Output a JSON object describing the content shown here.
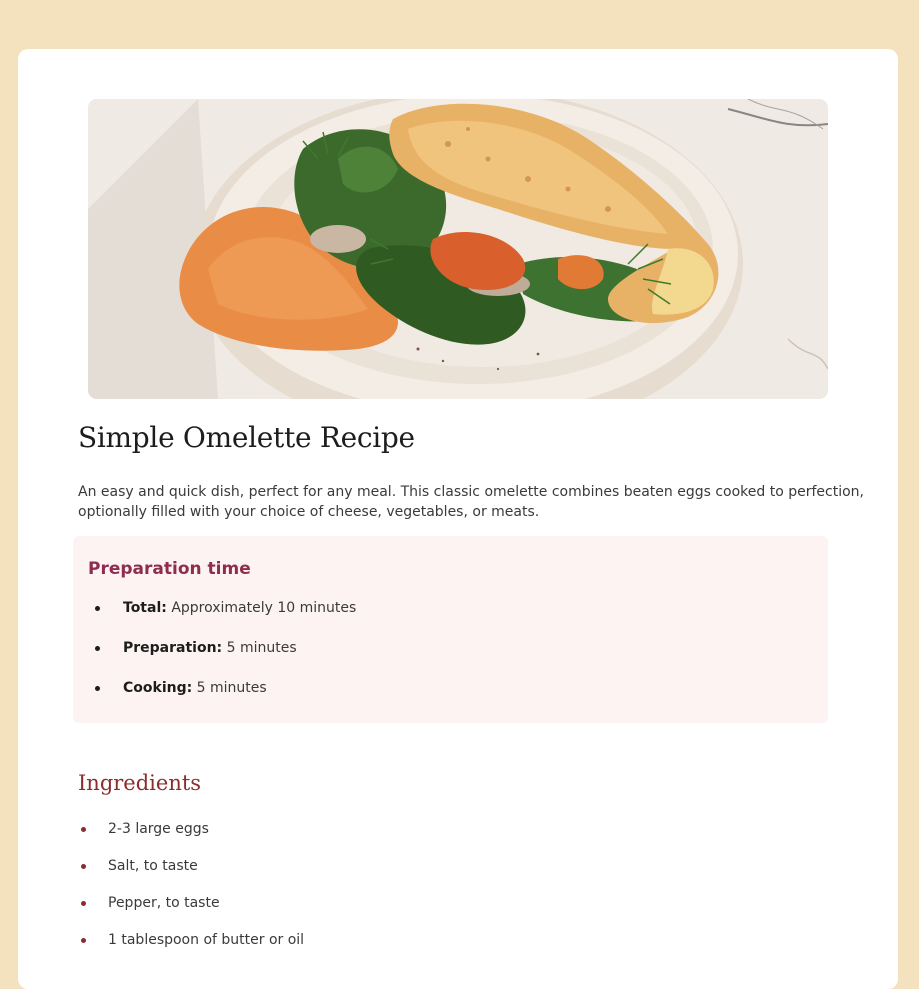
{
  "recipe": {
    "title": "Simple Omelette Recipe",
    "description": "An easy and quick dish, perfect for any meal. This classic omelette combines beaten eggs cooked to perfection, optionally filled with your choice of cheese, vegetables, or meats."
  },
  "preparation": {
    "heading": "Preparation time",
    "items": [
      {
        "label": "Total:",
        "value": "Approximately 10 minutes"
      },
      {
        "label": "Preparation:",
        "value": "5 minutes"
      },
      {
        "label": "Cooking:",
        "value": "5 minutes"
      }
    ]
  },
  "ingredients": {
    "heading": "Ingredients",
    "items": [
      "2-3 large eggs",
      "Salt, to taste",
      "Pepper, to taste",
      "1 tablespoon of butter or oil"
    ]
  },
  "colors": {
    "page_background": "#f4e1bd",
    "card_background": "#ffffff",
    "prep_background": "#fdf3f3",
    "prep_heading": "#8e2d4f",
    "ingredients_heading": "#8a2d2d"
  }
}
